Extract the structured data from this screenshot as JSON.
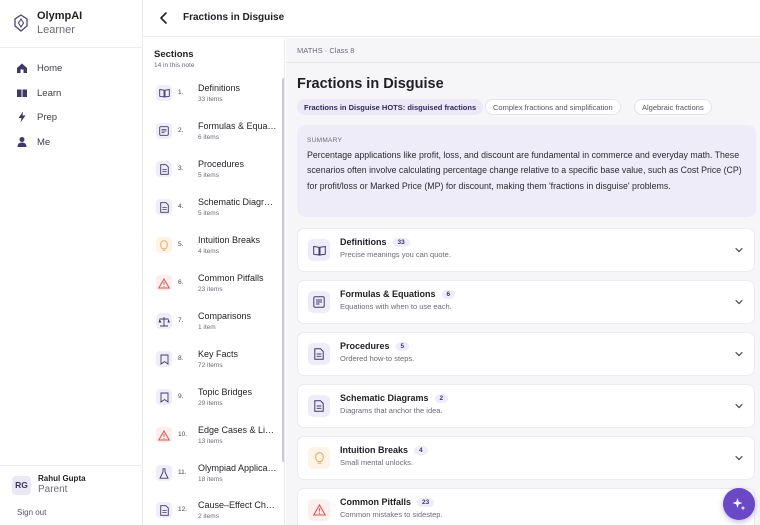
{
  "app": {
    "name": "OlympAI",
    "subtitle": "Learner"
  },
  "nav": {
    "items": [
      {
        "label": "Home",
        "icon": "home-icon"
      },
      {
        "label": "Learn",
        "icon": "book-icon"
      },
      {
        "label": "Prep",
        "icon": "bolt-icon"
      },
      {
        "label": "Me",
        "icon": "person-icon"
      }
    ]
  },
  "user": {
    "initials": "RG",
    "name": "Rahul Gupta",
    "role": "Parent",
    "signout": "Sign out"
  },
  "topbar": {
    "title": "Fractions in Disguise"
  },
  "sections": {
    "title": "Sections",
    "count": "14 in this note",
    "items": [
      {
        "num": "1.",
        "label": "Definitions",
        "sub": "33 items",
        "icon": "book-icon"
      },
      {
        "num": "2.",
        "label": "Formulas & Equations",
        "sub": "6 items",
        "icon": "formula-icon"
      },
      {
        "num": "3.",
        "label": "Procedures",
        "sub": "5 items",
        "icon": "doc-icon"
      },
      {
        "num": "4.",
        "label": "Schematic Diagrams",
        "sub": "5 items",
        "icon": "doc-icon"
      },
      {
        "num": "5.",
        "label": "Intuition Breaks",
        "sub": "4 items",
        "icon": "bulb-icon"
      },
      {
        "num": "6.",
        "label": "Common Pitfalls",
        "sub": "23 items",
        "icon": "warning-icon"
      },
      {
        "num": "7.",
        "label": "Comparisons",
        "sub": "1 item",
        "icon": "scale-icon"
      },
      {
        "num": "8.",
        "label": "Key Facts",
        "sub": "72 items",
        "icon": "bookmark-icon"
      },
      {
        "num": "9.",
        "label": "Topic Bridges",
        "sub": "29 items",
        "icon": "bookmark-icon"
      },
      {
        "num": "10.",
        "label": "Edge Cases & Limits",
        "sub": "13 items",
        "icon": "warning-icon"
      },
      {
        "num": "11.",
        "label": "Olympiad Applications",
        "sub": "18 items",
        "icon": "flask-icon"
      },
      {
        "num": "12.",
        "label": "Cause–Effect Chains",
        "sub": "2 items",
        "icon": "doc-icon"
      }
    ]
  },
  "main": {
    "breadcrumb": "MATHS · Class 8",
    "title": "Fractions in Disguise",
    "chips": [
      {
        "label": "Fractions in Disguise HOTS: disguised fractions",
        "active": true
      },
      {
        "label": "Complex fractions and simplification",
        "active": false
      },
      {
        "label": "Algebraic fractions",
        "active": false
      }
    ],
    "summary": {
      "label": "SUMMARY",
      "text": "Percentage applications like profit, loss, and discount are fundamental in commerce and everyday math. These scenarios often involve calculating percentage change relative to a specific base value, such as Cost Price (CP) for profit/loss or Marked Price (MP) for discount, making them 'fractions in disguise' problems."
    },
    "cards": [
      {
        "title": "Definitions",
        "count": "33",
        "sub": "Precise meanings you can quote.",
        "icon": "book-icon"
      },
      {
        "title": "Formulas & Equations",
        "count": "6",
        "sub": "Equations with when to use each.",
        "icon": "formula-icon"
      },
      {
        "title": "Procedures",
        "count": "5",
        "sub": "Ordered how-to steps.",
        "icon": "doc-icon"
      },
      {
        "title": "Schematic Diagrams",
        "count": "2",
        "sub": "Diagrams that anchor the idea.",
        "icon": "doc-icon"
      },
      {
        "title": "Intuition Breaks",
        "count": "4",
        "sub": "Small mental unlocks.",
        "icon": "bulb-icon"
      },
      {
        "title": "Common Pitfalls",
        "count": "23",
        "sub": "Common mistakes to sidestep.",
        "icon": "warning-icon"
      }
    ]
  },
  "colors": {
    "accent": "#6a48c6",
    "accent_soft": "#efecf9",
    "warning": "#d9534f",
    "bulb": "#e8a45a"
  }
}
